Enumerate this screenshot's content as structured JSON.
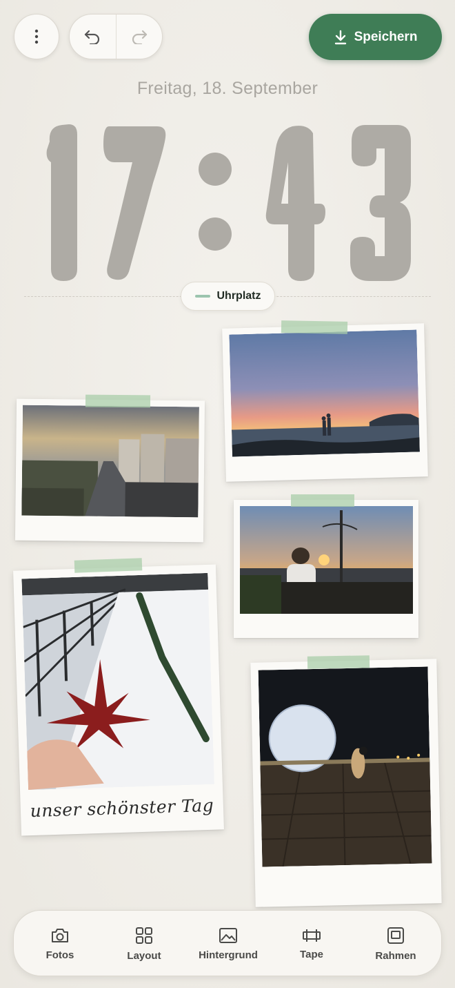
{
  "header": {
    "save_label": "Speichern"
  },
  "clock": {
    "date": "Freitag, 18. September",
    "time": "17:43",
    "slot_label": "Uhrplatz"
  },
  "collage": {
    "caption": "unser schönster Tag"
  },
  "toolbar": {
    "items": [
      {
        "label": "Fotos",
        "icon": "camera-icon"
      },
      {
        "label": "Layout",
        "icon": "grid-icon"
      },
      {
        "label": "Hintergrund",
        "icon": "image-icon"
      },
      {
        "label": "Tape",
        "icon": "tape-icon"
      },
      {
        "label": "Rahmen",
        "icon": "frame-icon"
      }
    ]
  },
  "colors": {
    "accent": "#3f7d56",
    "clock_digits": "#aeaba5",
    "background": "#efece6"
  }
}
